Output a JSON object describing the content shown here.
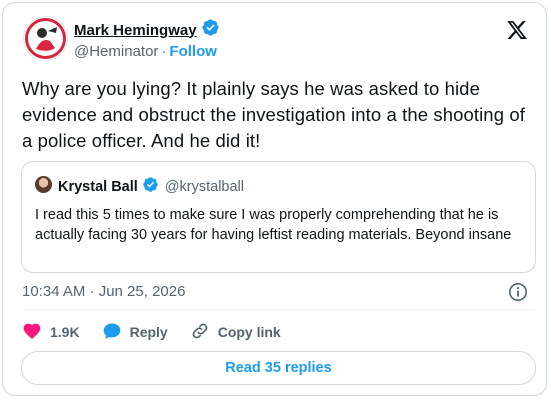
{
  "author": {
    "name": "Mark Hemingway",
    "handle": "@Heminator",
    "separator": "·",
    "follow_label": "Follow"
  },
  "tweet": {
    "text": "Why are you lying? It plainly says he was asked to hide evidence and obstruct the investigation into a the shooting of a police officer. And he did it!",
    "timestamp": "10:34 AM · Jun 25, 2026"
  },
  "quoted": {
    "name": "Krystal Ball",
    "handle": "@krystalball",
    "text": "I read this 5 times to make sure I was properly comprehending that he is actually facing 30 years for having leftist reading materials.  Beyond insane"
  },
  "actions": {
    "likes": "1.9K",
    "reply_label": "Reply",
    "copy_label": "Copy link"
  },
  "read_replies_label": "Read 35 replies",
  "icons": {
    "verified": "verified-badge-icon",
    "logo": "x-logo-icon",
    "info": "info-icon",
    "like": "heart-icon",
    "reply": "reply-bubble-icon",
    "copy": "link-icon"
  },
  "colors": {
    "accent": "#1d9bf0",
    "like": "#f91880",
    "text": "#0f1419",
    "muted": "#536471",
    "border": "#cfd9de"
  }
}
